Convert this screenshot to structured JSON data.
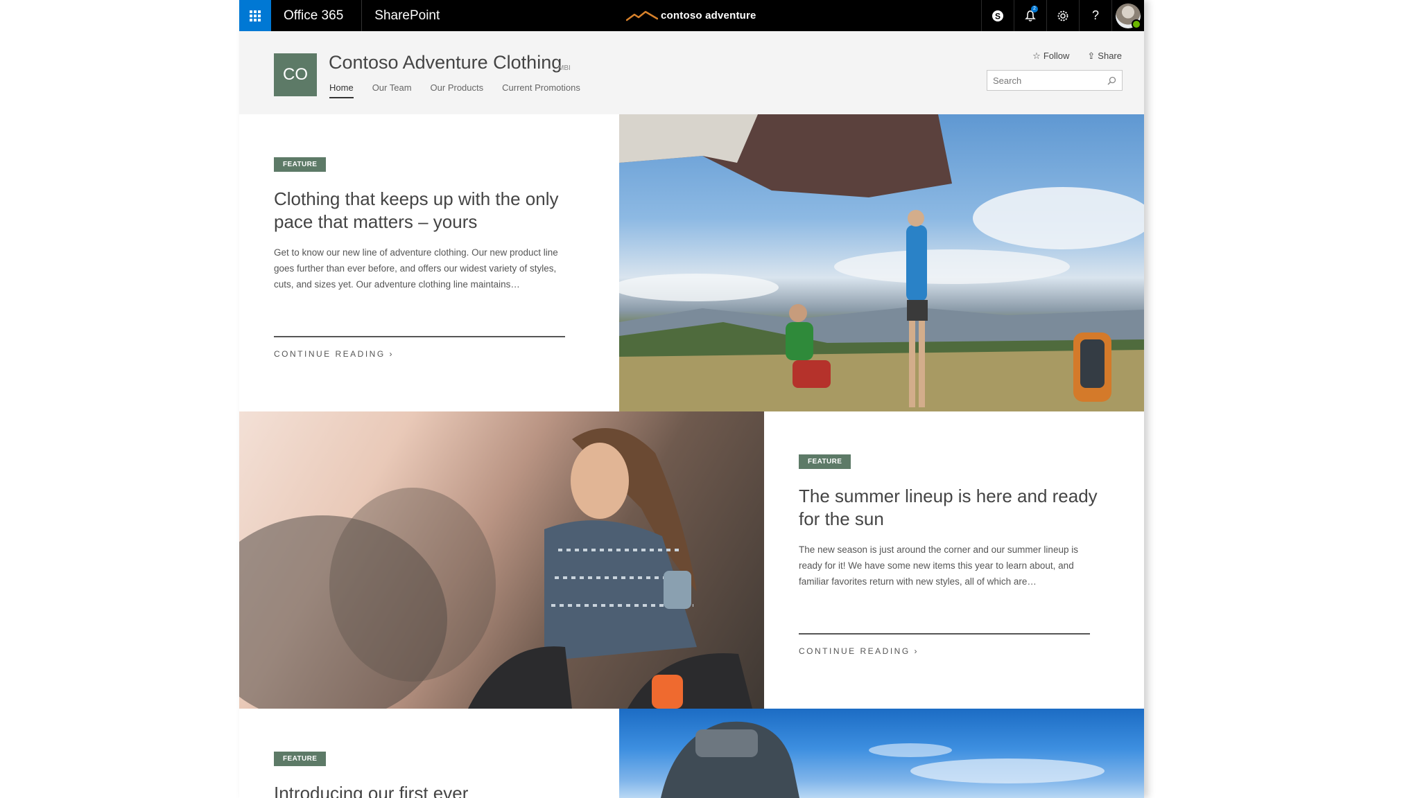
{
  "suite_bar": {
    "suite_name": "Office 365",
    "app_name": "SharePoint",
    "brand": "contoso adventure",
    "notification_count": "2",
    "help": "?",
    "accent": "#0078d4"
  },
  "site": {
    "logo_text": "CO",
    "title": "Contoso Adventure Clothing",
    "classification": "MBI",
    "nav": [
      "Home",
      "Our Team",
      "Our Products",
      "Current Promotions"
    ],
    "active_nav": "Home",
    "follow_label": "Follow",
    "share_label": "Share",
    "search_placeholder": "Search",
    "accent": "#5d7a67"
  },
  "cards": [
    {
      "badge": "FEATURE",
      "title": "Clothing that keeps up with the only pace that matters – yours",
      "body": "Get to know our new line of adventure clothing. Our new product line goes further than ever before, and offers our widest variety of styles, cuts, and sizes yet. Our adventure clothing line maintains…",
      "link": "CONTINUE READING ›"
    },
    {
      "badge": "FEATURE",
      "title": "The summer lineup is here and ready for the sun",
      "body": "The new season is just around the corner and our summer lineup is ready for it! We have some new items this year to learn about, and familiar favorites return with new styles, all of which are…",
      "link": "CONTINUE READING ›"
    },
    {
      "badge": "FEATURE",
      "title": "Introducing our first ever"
    }
  ]
}
